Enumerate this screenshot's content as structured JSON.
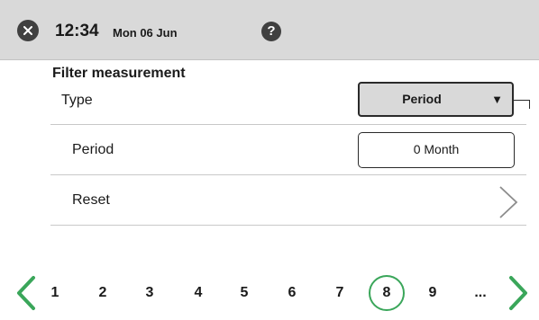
{
  "header": {
    "time": "12:34",
    "date": "Mon 06 Jun",
    "close_icon": "close-icon",
    "help_label": "?"
  },
  "filter": {
    "title": "Filter measurement",
    "type_label": "Type",
    "type_value": "Period",
    "type_arrow": "▼",
    "period_label": "Period",
    "period_value": "0 Month",
    "reset_label": "Reset"
  },
  "pager": {
    "pages": [
      "1",
      "2",
      "3",
      "4",
      "5",
      "6",
      "7",
      "8",
      "9",
      "..."
    ],
    "current_page": "8",
    "accent_color": "#3aa65a"
  },
  "colors": {
    "header_bg": "#d9d9d9",
    "accent": "#3aa65a"
  }
}
